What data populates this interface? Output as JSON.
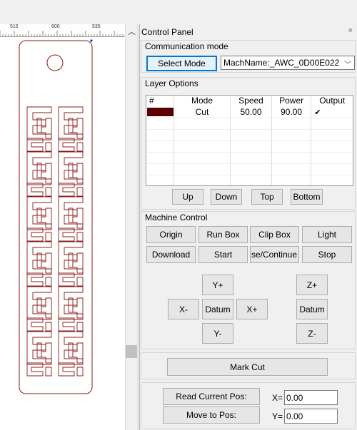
{
  "ruler": {
    "labels": [
      "515",
      "600",
      "535"
    ]
  },
  "panel": {
    "title": "Control Panel",
    "close_glyph": "×"
  },
  "communication": {
    "title": "Communication mode",
    "select_mode_label": "Select Mode",
    "machine_name": "MachName:_AWC_0D00E022"
  },
  "layers": {
    "title": "Layer Options",
    "columns": [
      "#",
      "Mode",
      "Speed",
      "Power",
      "Output"
    ],
    "rows": [
      {
        "color": "#5a0000",
        "mode": "Cut",
        "speed": "50.00",
        "power": "90.00",
        "output_checked": "✔"
      }
    ],
    "buttons": {
      "up": "Up",
      "down": "Down",
      "top": "Top",
      "bottom": "Bottom"
    }
  },
  "machine": {
    "title": "Machine Control",
    "origin": "Origin",
    "run_box": "Run Box",
    "clip_box": "Clip Box",
    "light": "Light",
    "download": "Download",
    "start": "Start",
    "pause": "Pause/Continue",
    "stop": "Stop",
    "y_plus": "Y+",
    "y_minus": "Y-",
    "x_minus": "X-",
    "x_plus": "X+",
    "datum": "Datum",
    "z_plus": "Z+",
    "z_datum": "Datum",
    "z_minus": "Z-"
  },
  "mark_cut": "Mark Cut",
  "position": {
    "read_current": "Read Current Pos:",
    "move_to": "Move to Pos:",
    "x_label": "X=",
    "y_label": "Y=",
    "x_value": "0.00",
    "y_value": "0.00"
  },
  "colors": {
    "cut_path": "#8b1a1a",
    "accent": "#0078d7"
  }
}
